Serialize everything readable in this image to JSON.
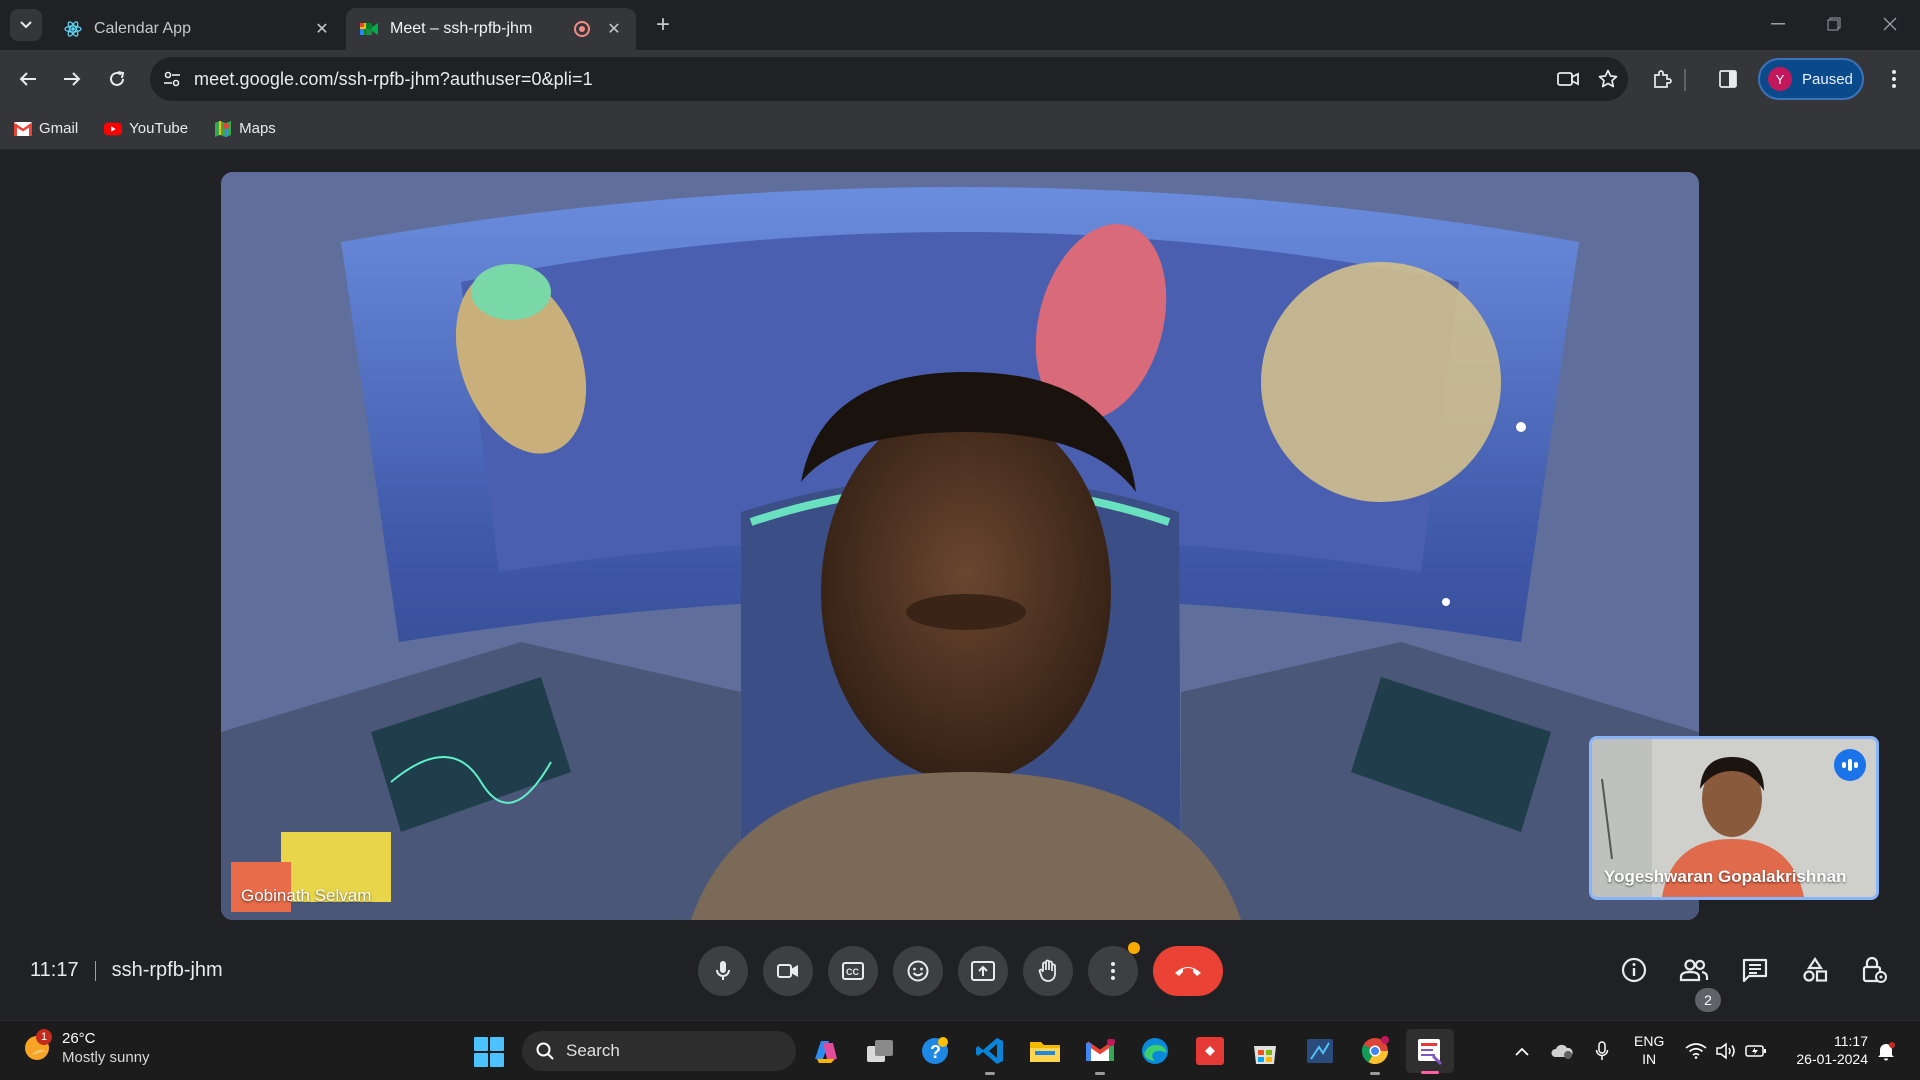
{
  "browser": {
    "tabs": [
      {
        "title": "Calendar App",
        "active": false
      },
      {
        "title": "Meet – ssh-rpfb-jhm",
        "active": true
      }
    ],
    "url": "meet.google.com/ssh-rpfb-jhm?authuser=0&pli=1",
    "profile": {
      "initial": "Y",
      "label": "Paused"
    },
    "bookmarks": [
      {
        "label": "Gmail",
        "icon": "gmail-icon"
      },
      {
        "label": "YouTube",
        "icon": "youtube-icon"
      },
      {
        "label": "Maps",
        "icon": "maps-icon"
      }
    ]
  },
  "meeting": {
    "main_participant": "Gobinath Selvam",
    "self_participant": "Yogeshwaran Gopalakrishnan",
    "time": "11:17",
    "code": "ssh-rpfb-jhm",
    "participant_count": "2",
    "controls": [
      "mic-icon",
      "camera-icon",
      "captions-icon",
      "emoji-icon",
      "present-icon",
      "raise-hand-icon",
      "more-options-icon",
      "hang-up-icon"
    ],
    "side_controls": [
      "info-icon",
      "people-icon",
      "chat-icon",
      "activities-icon",
      "host-controls-icon"
    ]
  },
  "taskbar": {
    "weather": {
      "temp": "26°C",
      "condition": "Mostly sunny",
      "badge": "1"
    },
    "search_placeholder": "Search",
    "language": {
      "line1": "ENG",
      "line2": "IN"
    },
    "clock": {
      "time": "11:17",
      "date": "26-01-2024"
    }
  },
  "colors": {
    "hangup": "#ea4335",
    "accent": "#8ab4f8",
    "profile_bg": "#0b4a8a"
  }
}
